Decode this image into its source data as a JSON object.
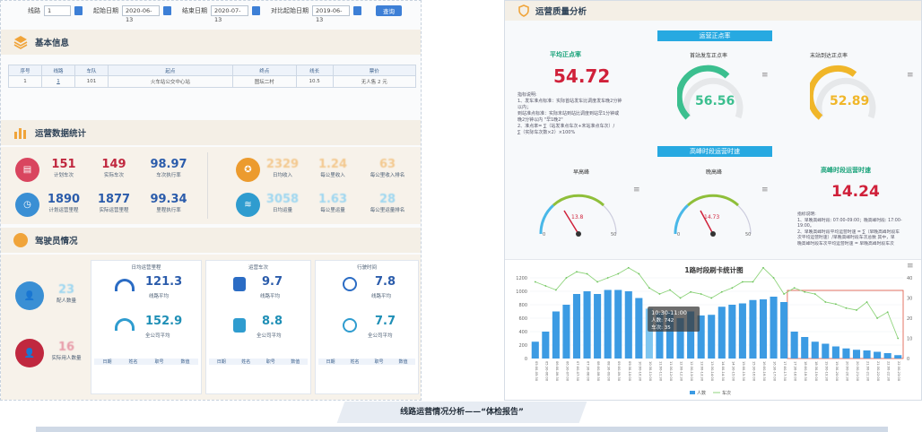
{
  "left": {
    "filters": {
      "line_label": "线路",
      "line_value": "1",
      "start_label": "起始日期",
      "start_value": "2020-06-13",
      "end_label": "结束日期",
      "end_value": "2020-07-13",
      "compare_label": "对比起始日期",
      "compare_value": "2019-06-13",
      "search_button": "查询"
    },
    "basic": {
      "title": "基本信息",
      "headers": [
        "序号",
        "线路",
        "车队",
        "起点",
        "终点",
        "线长",
        "票价"
      ],
      "row": [
        "1",
        "1",
        "101",
        "火车站公交中心站",
        "图坛二村",
        "10.5",
        "无人售 2 元"
      ]
    },
    "ops": {
      "title": "运营数据统计",
      "trips_planned": "151",
      "trips_planned_label": "计划车次",
      "trips_actual": "149",
      "trips_actual_label": "实际车次",
      "trips_rate": "98.97",
      "trips_rate_label": "车次执行率",
      "km_planned": "1890",
      "km_planned_label": "计划运营里程",
      "km_actual": "1877",
      "km_actual_label": "实际运营里程",
      "km_rate": "99.34",
      "km_rate_label": "里程执行率",
      "income_value": "2329",
      "income_label": "日均收入",
      "income_per_km": "1.24",
      "income_per_km_label": "每公里收入",
      "income_rank": "63",
      "income_rank_label": "每公里收入排名",
      "passengers_value": "3058",
      "passengers_label": "日均运量",
      "passengers_per_km": "1.63",
      "passengers_per_km_label": "每公里运量",
      "passengers_rank": "28",
      "passengers_rank_label": "每公里运量排名"
    },
    "drivers": {
      "title": "驾驶员情况",
      "assigned_value": "23",
      "assigned_label": "配人数量",
      "actual_value": "16",
      "actual_label": "实际用人数量",
      "mileage_title": "日均运营里程",
      "mileage_line": "121.3",
      "mileage_line_label": "线路平均",
      "mileage_company": "152.9",
      "mileage_company_label": "全公司平均",
      "trips_title": "运营车次",
      "trips_line": "9.7",
      "trips_line_label": "线路平均",
      "trips_company": "8.8",
      "trips_company_label": "全公司平均",
      "hours_title": "行驶时间",
      "hours_line": "7.8",
      "hours_line_label": "线路平均",
      "hours_company": "7.7",
      "hours_company_label": "全公司平均",
      "table_headers": [
        "日期",
        "姓名",
        "职号",
        "数值"
      ]
    }
  },
  "right": {
    "title": "运营质量分析",
    "punctuality_bar": "运营正点率",
    "avg_on_time_label": "平均正点率",
    "avg_on_time_value": "54.72",
    "depart_on_time_label": "首站发车正点率",
    "depart_on_time_value": "56.56",
    "arrive_on_time_label": "末站到达正点率",
    "arrive_on_time_value": "52.89",
    "notes_title": "指标说明:",
    "notes_lines": [
      "1、发车准点标准：实际首站发车比调度发车晚2分钟",
      "以内；",
      "到站准点标准：实际末站到站比调度到站早1分钟或",
      "晚2分钟以内 \"早1晚2\"",
      "2、准点率= ∑（站发准点车次+末站准点车次）/",
      "∑（实际车次数×2）×100%"
    ],
    "peak_bar": "高峰时段运营时速",
    "morning_peak_label": "早高峰",
    "morning_peak_value": "13.8",
    "evening_peak_label": "晚高峰",
    "evening_peak_value": "14.73",
    "peak_speed_label": "高峰时段运营时速",
    "peak_speed_value": "14.24",
    "peak_notes": [
      "指标说明:",
      "1、早晚高峰时段: 07:00-09:00；晚高峰时段: 17:00-",
      "19:00。",
      "2、早晚高峰时段平均运营时速 = ∑（早晚高峰时段车",
      "次平均运营时速）/早晚高峰时段车次总数 其中，早",
      "晚高峰时段车次平均运营时速 = 早晚高峰时段车次"
    ],
    "gauge_ticks": [
      "0",
      "10",
      "20",
      "30",
      "40",
      "50"
    ]
  },
  "chart_data": {
    "type": "bar",
    "title": "1路时段刷卡统计图",
    "categories": [
      "05:00-05:30",
      "05:30-06:00",
      "06:00-06:30",
      "06:30-07:00",
      "07:00-07:30",
      "07:30-08:00",
      "08:00-08:30",
      "08:30-09:00",
      "09:00-09:30",
      "09:30-10:00",
      "10:00-10:30",
      "10:30-11:00",
      "11:00-11:30",
      "11:30-12:00",
      "12:00-12:30",
      "12:30-13:00",
      "13:00-13:30",
      "13:30-14:00",
      "14:00-14:30",
      "14:30-15:00",
      "15:00-15:30",
      "15:30-16:00",
      "16:00-16:30",
      "16:30-17:00",
      "17:00-17:30",
      "17:30-18:00",
      "18:00-18:30",
      "18:30-19:00",
      "19:00-19:30",
      "19:30-20:00",
      "20:00-20:30",
      "20:30-21:00",
      "21:00-21:30",
      "21:30-22:00",
      "22:00-22:30",
      "22:30-23:00"
    ],
    "series": [
      {
        "name": "人数",
        "values": [
          250,
          400,
          700,
          800,
          960,
          1000,
          960,
          1020,
          1020,
          1000,
          900,
          742,
          680,
          700,
          600,
          700,
          640,
          650,
          770,
          800,
          820,
          870,
          880,
          920,
          840,
          400,
          320,
          250,
          220,
          180,
          150,
          130,
          120,
          100,
          80,
          50
        ]
      },
      {
        "name": "车次",
        "values": [
          38,
          36,
          34,
          40,
          43,
          42,
          38,
          40,
          42,
          45,
          42,
          35,
          32,
          34,
          30,
          33,
          32,
          30,
          33,
          35,
          38,
          38,
          45,
          40,
          32,
          35,
          33,
          32,
          28,
          27,
          25,
          24,
          28,
          20,
          23,
          10
        ]
      }
    ],
    "ylim_left": [
      0,
      1200
    ],
    "ylim_right": [
      0,
      40
    ],
    "yticks_left": [
      "0",
      "200",
      "400",
      "600",
      "800",
      "1000",
      "1200"
    ],
    "yticks_right": [
      "0",
      "10",
      "20",
      "30",
      "40"
    ],
    "tooltip_time": "10:30-11:00",
    "tooltip_people": "人数: 742",
    "tooltip_trips": "车次: 35",
    "legend": [
      "人数",
      "车次"
    ]
  },
  "caption": "线路运营情况分析——“体检报告”"
}
